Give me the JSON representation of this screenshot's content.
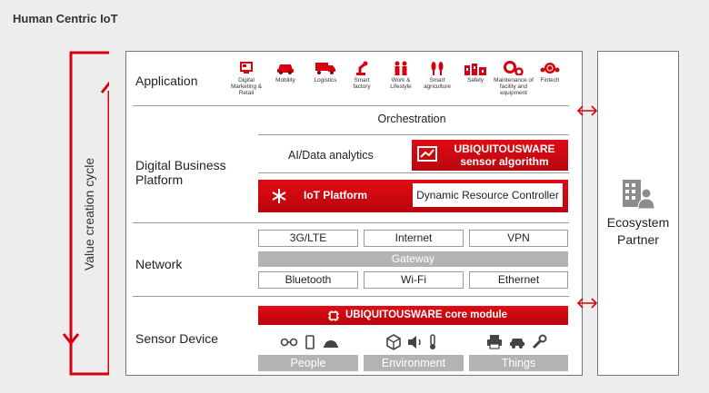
{
  "title": "Human Centric IoT",
  "value_cycle_label": "Value creation cycle",
  "layers": {
    "application": "Application",
    "platform_line1": "Digital Business",
    "platform_line2": "Platform",
    "network": "Network",
    "sensor": "Sensor Device"
  },
  "applications": [
    {
      "icon": "digital-marketing-icon",
      "lines": [
        "Digital",
        "Marketing &",
        "Retail"
      ]
    },
    {
      "icon": "car-icon",
      "lines": [
        "Mobility"
      ]
    },
    {
      "icon": "truck-icon",
      "lines": [
        "Logistics"
      ]
    },
    {
      "icon": "robot-arm-icon",
      "lines": [
        "Smart",
        "factory"
      ]
    },
    {
      "icon": "people-icon",
      "lines": [
        "Work &",
        "Lifestyle"
      ]
    },
    {
      "icon": "crop-icon",
      "lines": [
        "Smart",
        "agriculture"
      ]
    },
    {
      "icon": "factory-icon",
      "lines": [
        "Safety"
      ]
    },
    {
      "icon": "gears-icon",
      "lines": [
        "Maintenance of",
        "facility and",
        "equipment"
      ]
    },
    {
      "icon": "coin-globe-icon",
      "lines": [
        "Fintech"
      ]
    }
  ],
  "platform": {
    "orchestration": "Orchestration",
    "analytics": "AI/Data analytics",
    "sensor_algo_line1": "UBIQUITOUSWARE",
    "sensor_algo_line2": "sensor  algorithm",
    "iot_platform": "IoT Platform",
    "drc": "Dynamic Resource Controller"
  },
  "network": {
    "row1": [
      "3G/LTE",
      "Internet",
      "VPN"
    ],
    "gateway": "Gateway",
    "row2": [
      "Bluetooth",
      "Wi-Fi",
      "Ethernet"
    ]
  },
  "sensor": {
    "core_module": "UBIQUITOUSWARE core module",
    "groups": [
      "People",
      "Environment",
      "Things"
    ],
    "icons": [
      "glasses-icon",
      "phone-icon",
      "helmet-icon",
      "cube-icon",
      "speaker-icon",
      "thermometer-icon",
      "printer-icon",
      "car-icon",
      "wrench-icon"
    ]
  },
  "partner": {
    "line1": "Ecosystem",
    "line2": "Partner",
    "icon": "building-person-icon"
  },
  "colors": {
    "red": "#d7000f",
    "gray_bar": "#b3b3b3",
    "frame": "#777777",
    "background": "#ededed"
  }
}
